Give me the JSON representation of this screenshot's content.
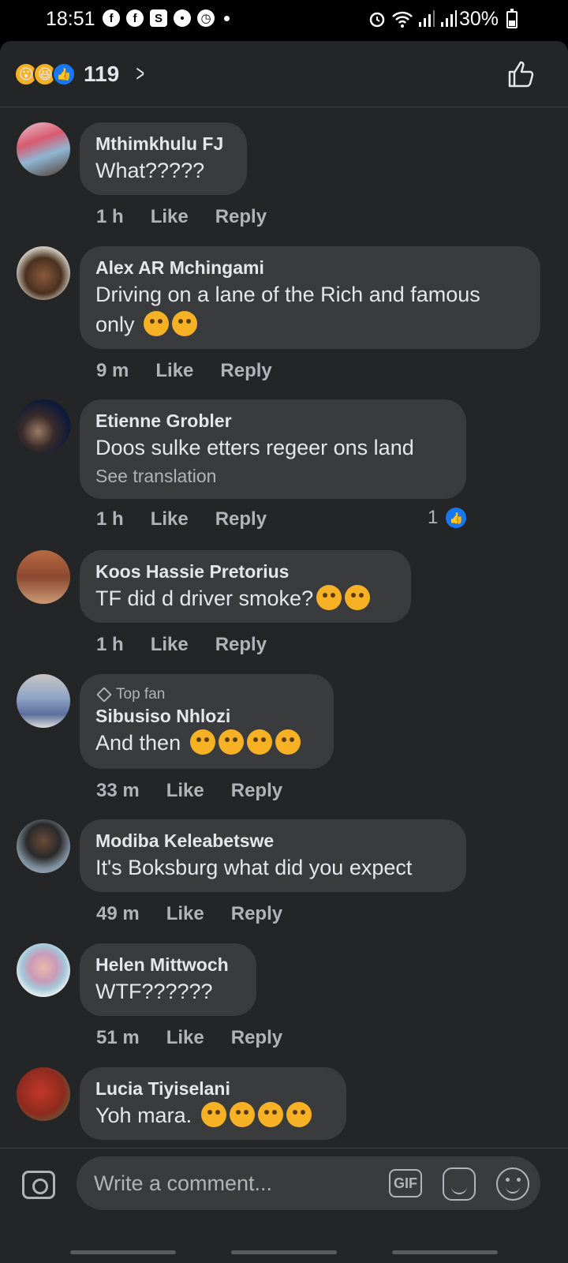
{
  "status_bar": {
    "time": "18:51",
    "battery": "30%",
    "left_icons": [
      "facebook-icon",
      "facebook-icon",
      "s-app-icon",
      "android-icon",
      "alarm-icon"
    ],
    "right_icons": [
      "alarm-icon",
      "wifi-icon",
      "signal-icon",
      "signal-icon"
    ]
  },
  "header": {
    "reaction_count": "119",
    "reactions": [
      "wow",
      "haha",
      "like"
    ]
  },
  "comments": [
    {
      "author": "Mthimkhulu FJ",
      "text": "What?????",
      "time": "1 h",
      "like": "Like",
      "reply": "Reply",
      "emojis": 0
    },
    {
      "author": "Alex AR Mchingami",
      "text_line1": "Driving on a lane of the Rich and famous",
      "text_line2": "only",
      "time": "9 m",
      "like": "Like",
      "reply": "Reply",
      "emojis": 2
    },
    {
      "author": "Etienne Grobler",
      "text": "Doos sulke etters regeer ons land",
      "see_translation": "See translation",
      "time": "1 h",
      "like": "Like",
      "reply": "Reply",
      "reaction_count": "1"
    },
    {
      "author": "Koos Hassie Pretorius",
      "text": "TF did d driver smoke?",
      "time": "1 h",
      "like": "Like",
      "reply": "Reply",
      "emojis": 2
    },
    {
      "badge": "Top fan",
      "author": "Sibusiso Nhlozi",
      "text": "And then",
      "time": "33 m",
      "like": "Like",
      "reply": "Reply",
      "emojis": 4
    },
    {
      "author": "Modiba Keleabetswe",
      "text": "It's Boksburg what did you expect",
      "time": "49 m",
      "like": "Like",
      "reply": "Reply"
    },
    {
      "author": "Helen Mittwoch",
      "text": "WTF??????",
      "time": "51 m",
      "like": "Like",
      "reply": "Reply"
    },
    {
      "author": "Lucia Tiyiselani",
      "text": "Yoh mara.",
      "emojis": 4
    }
  ],
  "composer": {
    "placeholder": "Write a comment...",
    "gif_label": "GIF"
  },
  "colors": {
    "background": "#242526",
    "bubble": "#3a3b3c",
    "text": "#e4e6eb",
    "secondary_text": "#b0b3b8",
    "like_blue": "#1877f2"
  }
}
